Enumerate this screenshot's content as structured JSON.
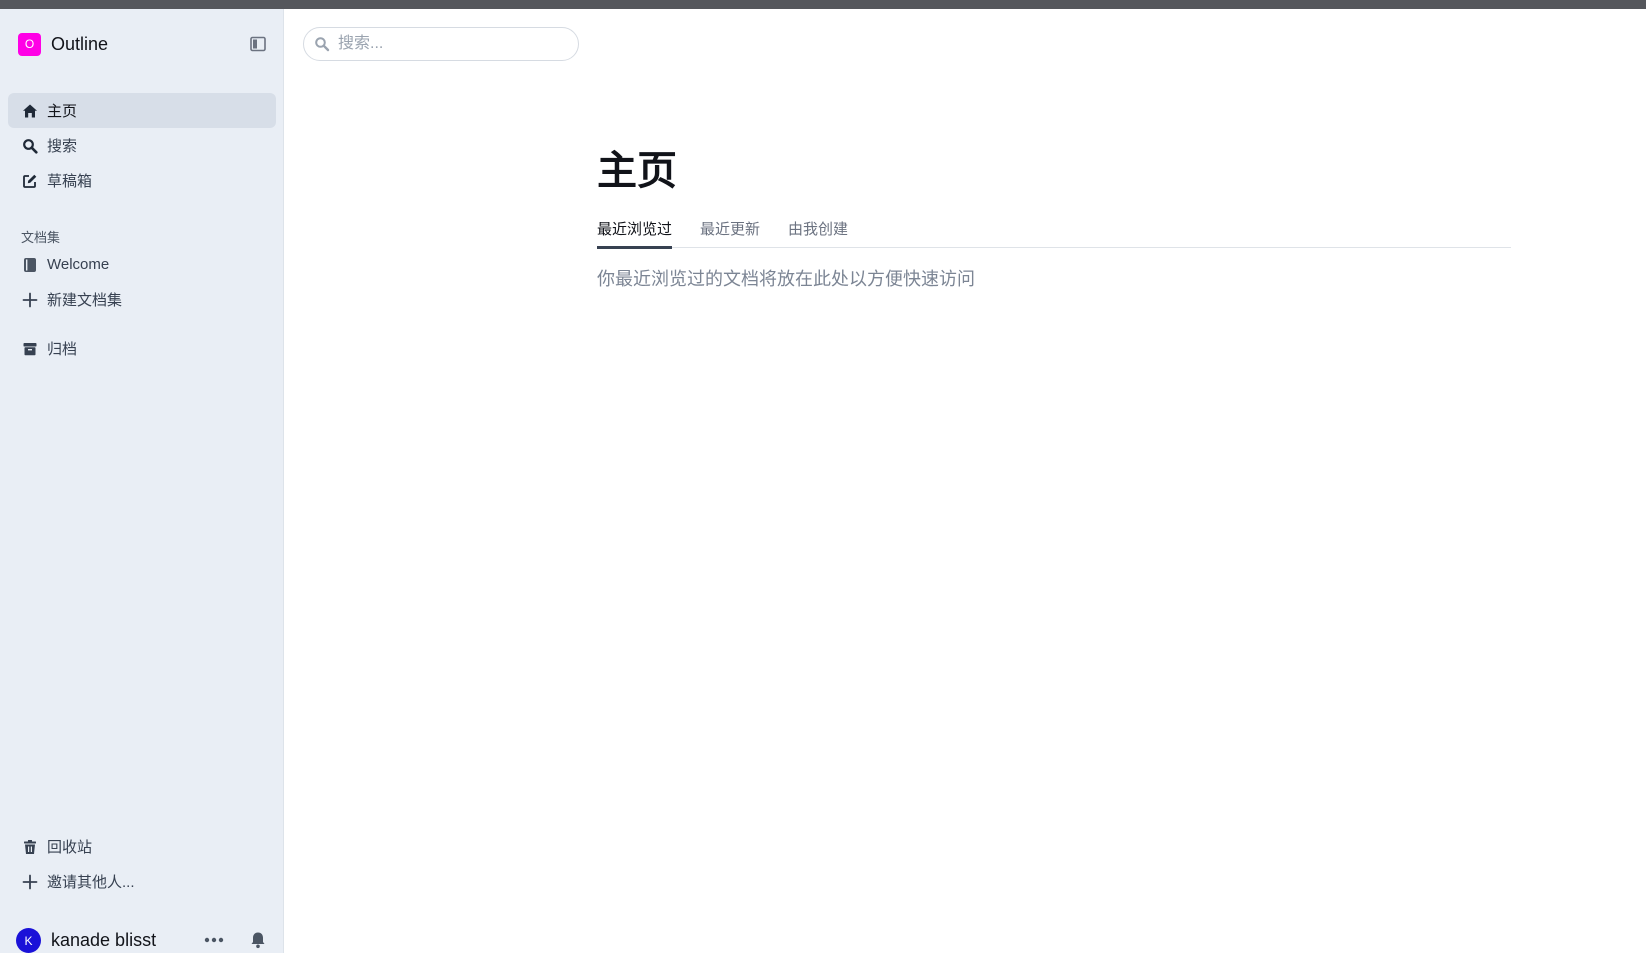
{
  "sidebar": {
    "team": {
      "logo_letter": "O",
      "name": "Outline",
      "logo_color": "#ff00e6"
    },
    "nav": [
      {
        "label": "主页",
        "icon": "home-icon",
        "active": true
      },
      {
        "label": "搜索",
        "icon": "search-icon"
      },
      {
        "label": "草稿箱",
        "icon": "edit-icon"
      }
    ],
    "collections_section": {
      "label": "文档集"
    },
    "collections": [
      {
        "label": "Welcome",
        "icon": "book-icon"
      },
      {
        "label": "新建文档集",
        "icon": "plus-icon"
      }
    ],
    "archive": {
      "label": "归档",
      "icon": "archive-icon"
    },
    "trash": {
      "label": "回收站",
      "icon": "trash-icon"
    },
    "invite": {
      "label": "邀请其他人...",
      "icon": "plus-icon"
    },
    "user": {
      "avatar_letter": "K",
      "name": "kanade blisst",
      "avatar_color": "#1a11d8"
    }
  },
  "header": {
    "search": {
      "placeholder": "搜索..."
    }
  },
  "main": {
    "title": "主页",
    "tabs": [
      {
        "label": "最近浏览过",
        "active": true
      },
      {
        "label": "最近更新"
      },
      {
        "label": "由我创建"
      }
    ],
    "empty_message": "你最近浏览过的文档将放在此处以方便快速访问"
  }
}
